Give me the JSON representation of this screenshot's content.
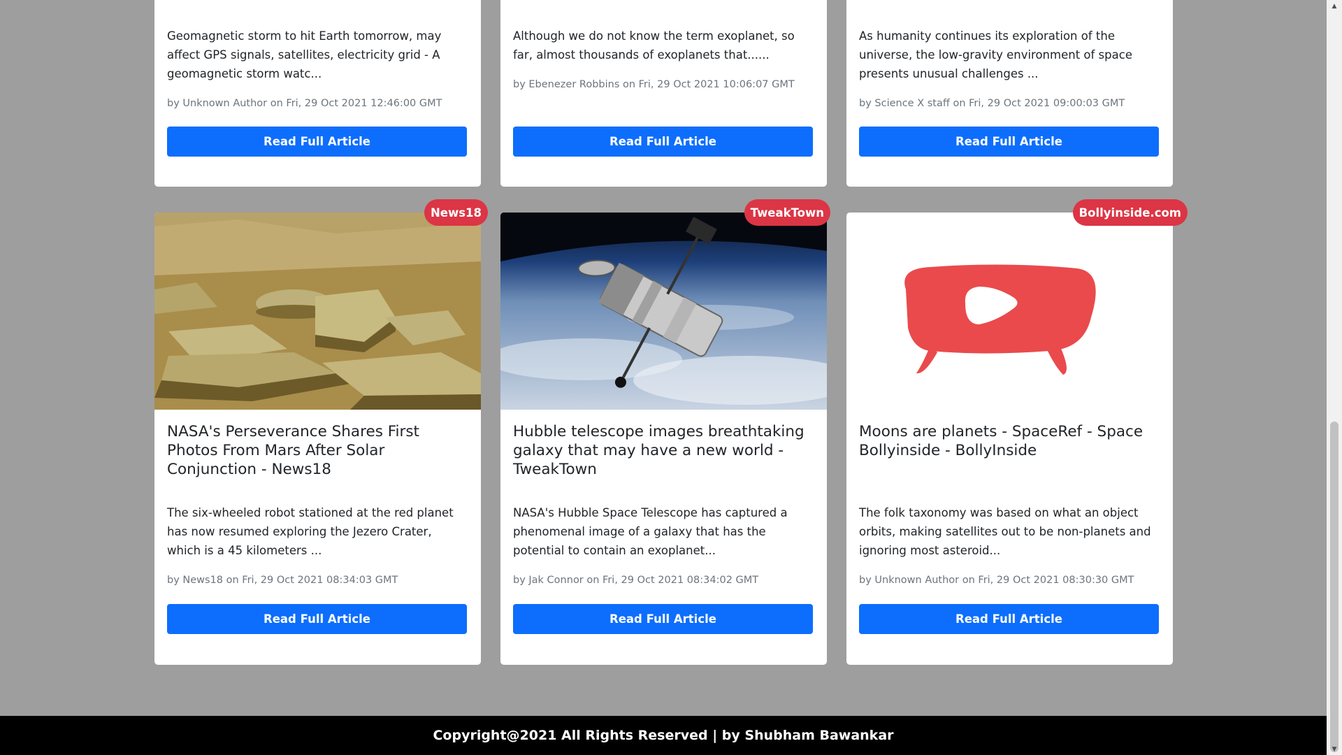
{
  "row1": [
    {
      "description": "Geomagnetic storm to hit Earth tomorrow, may affect GPS signals, satellites, electricity grid - A geomagnetic storm watc...",
      "meta": "by Unknown Author on Fri, 29 Oct 2021 12:46:00 GMT",
      "button": "Read Full Article"
    },
    {
      "description": "Although we do not know the term exoplanet, so far, almost thousands of exoplanets that......",
      "meta": "by Ebenezer Robbins on Fri, 29 Oct 2021 10:06:07 GMT",
      "button": "Read Full Article"
    },
    {
      "description": "As humanity continues its exploration of the universe, the low-gravity environment of space presents unusual challenges ...",
      "meta": "by Science X staff on Fri, 29 Oct 2021 09:00:03 GMT",
      "button": "Read Full Article"
    }
  ],
  "row2": [
    {
      "source": "News18",
      "title": "NASA's Perseverance Shares First Photos From Mars After Solar Conjunction - News18",
      "description": "The six-wheeled robot stationed at the red planet has now resumed exploring the Jezero Crater, which is a 45 kilometers ...",
      "meta": "by News18 on Fri, 29 Oct 2021 08:34:03 GMT",
      "button": "Read Full Article"
    },
    {
      "source": "TweakTown",
      "title": "Hubble telescope images breathtaking galaxy that may have a new world - TweakTown",
      "description": "NASA's Hubble Space Telescope has captured a phenomenal image of a galaxy that has the potential to contain an exoplanet...",
      "meta": "by Jak Connor on Fri, 29 Oct 2021 08:34:02 GMT",
      "button": "Read Full Article"
    },
    {
      "source": "Bollyinside.com",
      "title": "Moons are planets - SpaceRef - Space Bollyinside - BollyInside",
      "description": "The folk taxonomy was based on what an object orbits, making satellites out to be non-planets and ignoring most asteroid...",
      "meta": "by Unknown Author on Fri, 29 Oct 2021 08:30:30 GMT",
      "button": "Read Full Article"
    }
  ],
  "footer": {
    "text": "Copyright@2021 All Rights Reserved | by Shubham Bawankar"
  },
  "colors": {
    "background": "#9e9e9e",
    "button": "#0d6efd",
    "badge": "#dc3545",
    "footer": "#000000"
  }
}
